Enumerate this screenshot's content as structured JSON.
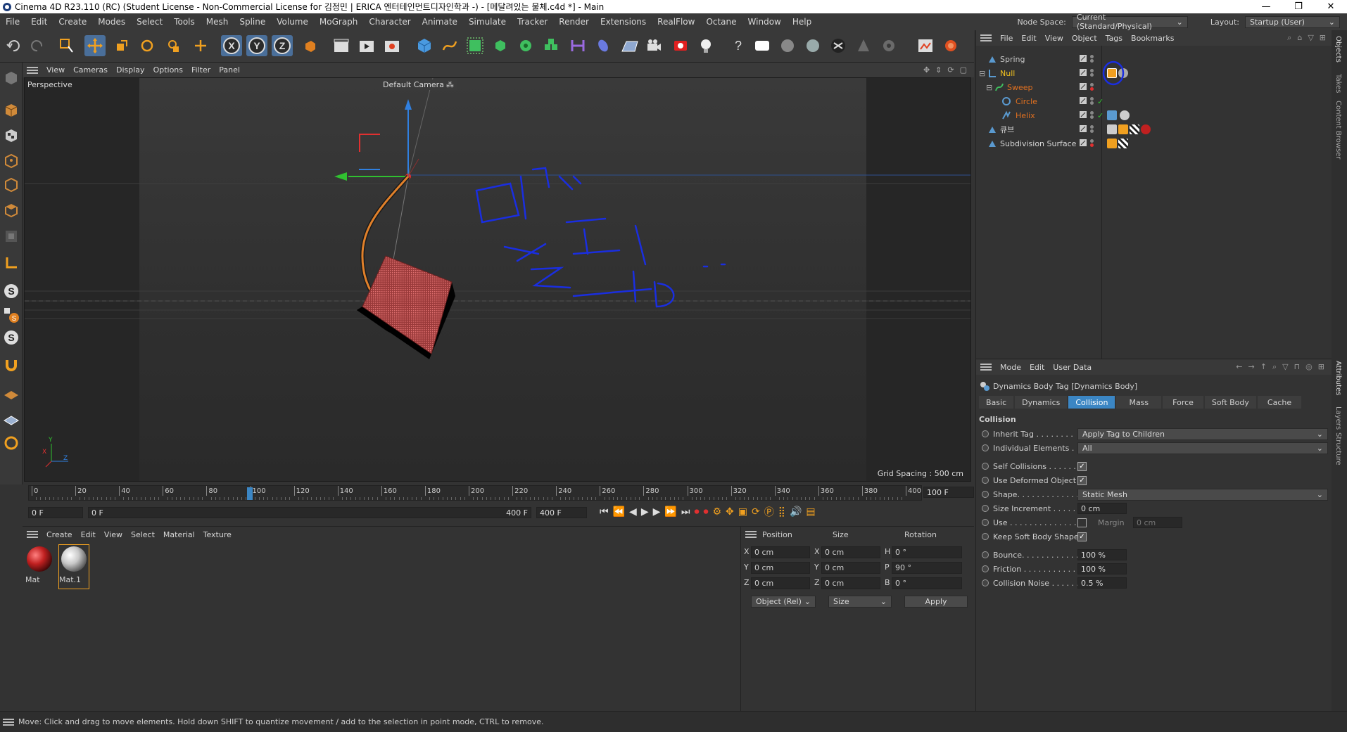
{
  "window": {
    "title": "Cinema 4D R23.110 (RC) (Student License - Non-Commercial License for 김정민 | ERICA 엔터테인먼트디자인학과 -) - [메달려있는 물체.c4d *] - Main",
    "controls": [
      "—",
      "❐",
      "✕"
    ]
  },
  "menubar": {
    "items": [
      "File",
      "Edit",
      "Create",
      "Modes",
      "Select",
      "Tools",
      "Mesh",
      "Spline",
      "Volume",
      "MoGraph",
      "Character",
      "Animate",
      "Simulate",
      "Tracker",
      "Render",
      "Extensions",
      "RealFlow",
      "Octane",
      "Window",
      "Help"
    ],
    "node_space_label": "Node Space:",
    "node_space_value": "Current (Standard/Physical)",
    "layout_label": "Layout:",
    "layout_value": "Startup (User)"
  },
  "viewport": {
    "menu": [
      "View",
      "Cameras",
      "Display",
      "Options",
      "Filter",
      "Panel"
    ],
    "view_name": "Perspective",
    "camera_label": "Default Camera",
    "grid_spacing": "Grid Spacing : 500 cm",
    "axis_y": "Y",
    "axis_x": "X",
    "axis_z": "Z"
  },
  "timeline": {
    "ticks": [
      "0",
      "20",
      "40",
      "60",
      "80",
      "100",
      "120",
      "140",
      "160",
      "180",
      "200",
      "220",
      "240",
      "260",
      "280",
      "300",
      "320",
      "340",
      "360",
      "380",
      "400"
    ],
    "current_frame_field": "100 F",
    "start_field": "0 F",
    "range_start": "0 F",
    "range_end": "400 F",
    "end_field": "400 F"
  },
  "materials": {
    "menu": [
      "Create",
      "Edit",
      "View",
      "Select",
      "Material",
      "Texture"
    ],
    "items": [
      {
        "name": "Mat",
        "color": "#c02020"
      },
      {
        "name": "Mat.1",
        "color": "#d0d0d0"
      }
    ]
  },
  "coordinates": {
    "headers": [
      "Position",
      "Size",
      "Rotation"
    ],
    "rows": [
      {
        "axis": "X",
        "pos": "0 cm",
        "size_axis": "X",
        "size": "0 cm",
        "rot_axis": "H",
        "rot": "0 °"
      },
      {
        "axis": "Y",
        "pos": "0 cm",
        "size_axis": "Y",
        "size": "0 cm",
        "rot_axis": "P",
        "rot": "90 °"
      },
      {
        "axis": "Z",
        "pos": "0 cm",
        "size_axis": "Z",
        "size": "0 cm",
        "rot_axis": "B",
        "rot": "0 °"
      }
    ],
    "mode_select": "Object (Rel)",
    "size_select": "Size",
    "apply_label": "Apply"
  },
  "object_manager": {
    "menu": [
      "File",
      "Edit",
      "View",
      "Object",
      "Tags",
      "Bookmarks"
    ],
    "objects": [
      {
        "name": "Spring",
        "color": "#c8c8c8"
      },
      {
        "name": "Null",
        "color": "#f0c020"
      },
      {
        "name": "Sweep",
        "color": "#e07020"
      },
      {
        "name": "Circle",
        "color": "#e07020"
      },
      {
        "name": "Helix",
        "color": "#e07020"
      },
      {
        "name": "큐브",
        "color": "#d8d8d8"
      },
      {
        "name": "Subdivision Surface",
        "color": "#d8d8d8"
      }
    ]
  },
  "attributes": {
    "menu": [
      "Mode",
      "Edit",
      "User Data"
    ],
    "tag_title": "Dynamics Body Tag [Dynamics Body]",
    "tabs": [
      "Basic",
      "Dynamics",
      "Collision",
      "Mass",
      "Force",
      "Soft Body",
      "Cache"
    ],
    "active_tab": "Collision",
    "section": "Collision",
    "inherit_tag_label": "Inherit Tag . . . . . . . .",
    "inherit_tag_value": "Apply Tag to Children",
    "individual_label": "Individual Elements . .",
    "individual_value": "All",
    "self_collisions_label": "Self Collisions . . . . . .",
    "use_deformed_label": "Use Deformed Object",
    "shape_label": "Shape. . . . . . . . . . . . .",
    "shape_value": "Static Mesh",
    "size_increment_label": "Size Increment . . . . . .",
    "size_increment_value": "0 cm",
    "use_label": "Use . . . . . . . . . . . . . .",
    "margin_label": "Margin",
    "margin_value": "0 cm",
    "keep_soft_label": "Keep Soft Body Shape",
    "bounce_label": "Bounce. . . . . . . . . . . .",
    "bounce_value": "100 %",
    "friction_label": "Friction . . . . . . . . . . . .",
    "friction_value": "100 %",
    "noise_label": "Collision Noise . . . . . .",
    "noise_value": "0.5 %"
  },
  "side_tabs": [
    "Objects",
    "Takes",
    "Content Browser",
    "Attributes",
    "Layers",
    "Structure"
  ],
  "status": {
    "text": "Move: Click and drag to move elements. Hold down SHIFT to quantize movement / add to the selection in point mode, CTRL to remove."
  },
  "colors": {
    "accent_blue": "#3b86c4",
    "axis_x_red": "#e03030",
    "axis_y_green": "#30c030",
    "axis_z_blue": "#3080e0",
    "cube_red": "#b03a3a",
    "annotation_blue": "#1a2ee0"
  }
}
